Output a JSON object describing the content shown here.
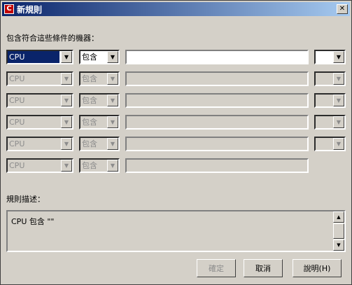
{
  "window": {
    "title": "新規則",
    "app_icon_letter": "C"
  },
  "condition_label": "包含符合這些條件的機器：",
  "rows": [
    {
      "field": "CPU",
      "op": "包含",
      "enabled": true
    },
    {
      "field": "CPU",
      "op": "包含",
      "enabled": false
    },
    {
      "field": "CPU",
      "op": "包含",
      "enabled": false
    },
    {
      "field": "CPU",
      "op": "包含",
      "enabled": false
    },
    {
      "field": "CPU",
      "op": "包含",
      "enabled": false
    },
    {
      "field": "CPU",
      "op": "包含",
      "enabled": false
    }
  ],
  "description_label": "規則描述：",
  "description_text": "CPU 包含 \"\"",
  "buttons": {
    "ok": "確定",
    "cancel": "取消",
    "help": "說明(H)"
  }
}
